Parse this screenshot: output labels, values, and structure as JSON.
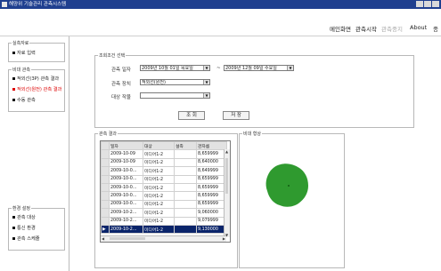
{
  "window": {
    "title": "해양위 기술관리 관측시스템"
  },
  "menu": {
    "items": [
      {
        "label": "메인화면",
        "disabled": false
      },
      {
        "label": "관측시작",
        "disabled": false
      },
      {
        "label": "관측중지",
        "disabled": true
      },
      {
        "label": "About",
        "disabled": false
      },
      {
        "label": "종",
        "disabled": false
      }
    ]
  },
  "sidebar": {
    "groups": [
      {
        "title": "실측자료",
        "items": [
          {
            "label": "자료 입력",
            "active": false
          }
        ]
      },
      {
        "title": "비대 관측",
        "items": [
          {
            "label": "적외선(3P) 관측 결과",
            "active": false
          },
          {
            "label": "적외선(원전) 관측 결과",
            "active": true
          },
          {
            "label": "수동 관측",
            "active": false
          }
        ]
      },
      {
        "title": "환경 설정",
        "items": [
          {
            "label": "관측 대상",
            "active": false
          },
          {
            "label": "통신 환경",
            "active": false
          },
          {
            "label": "관측 스케줄",
            "active": false
          }
        ]
      }
    ]
  },
  "search": {
    "title": "조회조건 선택",
    "date_label": "관측 일자",
    "date_from": "2009년 10월 01일 목요일",
    "tilde": "~",
    "date_to": "2009년 12월 09일 수요일",
    "device_label": "관측 장치",
    "device_value": "적외선(원전)",
    "target_label": "대상 작물",
    "target_value": "",
    "search_button": "조 회",
    "save_button": "저 장"
  },
  "results": {
    "title": "관측 결과",
    "columns": [
      "일자",
      "대상",
      "설측",
      "관자름"
    ],
    "rows": [
      {
        "date": "2009-10-09",
        "target": "미디어1-2",
        "actual": "",
        "value": "8,659999"
      },
      {
        "date": "2009-10-09",
        "target": "미디어1-2",
        "actual": "",
        "value": "8,640000"
      },
      {
        "date": "2009-10-0...",
        "target": "미디어1-2",
        "actual": "",
        "value": "8,649999"
      },
      {
        "date": "2009-10-0...",
        "target": "미디어1-2",
        "actual": "",
        "value": "8,659999"
      },
      {
        "date": "2009-10-0...",
        "target": "미디어1-2",
        "actual": "",
        "value": "8,659999"
      },
      {
        "date": "2009-10-0...",
        "target": "미디어1-2",
        "actual": "",
        "value": "8,659999"
      },
      {
        "date": "2009-10-0...",
        "target": "미디어1-2",
        "actual": "",
        "value": "8,659999"
      },
      {
        "date": "2009-10-2...",
        "target": "미디어1-2",
        "actual": "",
        "value": "9,060000"
      },
      {
        "date": "2009-10-2...",
        "target": "미디어1-2",
        "actual": "",
        "value": "9,079999"
      },
      {
        "date": "2009-10-2...",
        "target": "미디어1-2",
        "actual": "",
        "value": "9,130000"
      }
    ],
    "selected_row_marker": "▶"
  },
  "shape": {
    "title": "비대 형상",
    "fill_color": "#2f9a2f"
  }
}
